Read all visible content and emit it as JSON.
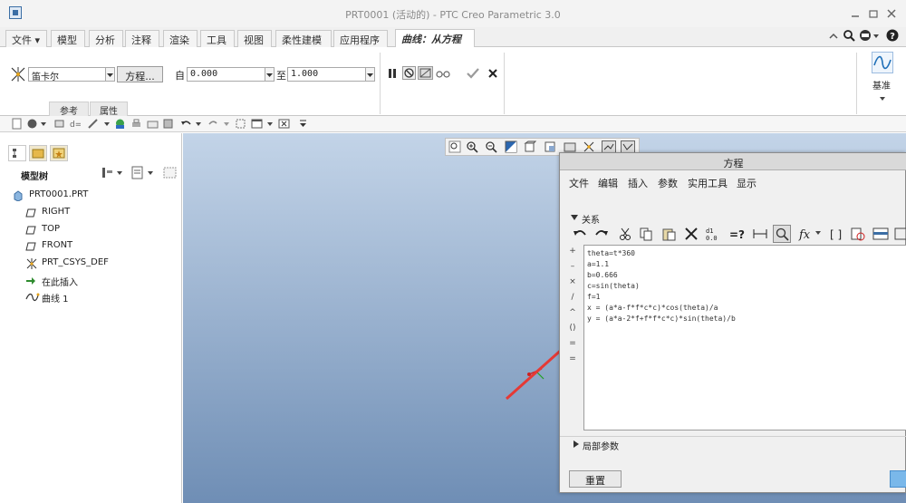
{
  "window": {
    "title": "PRT0001 (活动的) - PTC Creo Parametric 3.0"
  },
  "tabs": [
    {
      "label": "文件"
    },
    {
      "label": "模型"
    },
    {
      "label": "分析"
    },
    {
      "label": "注释"
    },
    {
      "label": "渲染"
    },
    {
      "label": "工具"
    },
    {
      "label": "视图"
    },
    {
      "label": "柔性建模"
    },
    {
      "label": "应用程序"
    },
    {
      "label": "曲线：从方程"
    }
  ],
  "ribbon": {
    "coord_system": "笛卡尔",
    "equation_button": "方程...",
    "from_label": "自",
    "from_value": "0.000",
    "to_label": "至",
    "to_value": "1.000",
    "subtabs": [
      "参考",
      "属性"
    ],
    "datum_label": "基准"
  },
  "left_pane": {
    "header": "模型树",
    "items": [
      {
        "label": "PRT0001.PRT",
        "icon": "part-icon"
      },
      {
        "label": "RIGHT",
        "icon": "datum-plane-icon"
      },
      {
        "label": "TOP",
        "icon": "datum-plane-icon"
      },
      {
        "label": "FRONT",
        "icon": "datum-plane-icon"
      },
      {
        "label": "PRT_CSYS_DEF",
        "icon": "csys-icon"
      },
      {
        "label": "在此插入",
        "icon": "insert-arrow-icon"
      },
      {
        "label": "曲线 1",
        "icon": "curve-icon"
      }
    ]
  },
  "dialog": {
    "title": "方程",
    "menu": [
      "文件",
      "编辑",
      "插入",
      "参数",
      "实用工具",
      "显示"
    ],
    "section": "关系",
    "equations": [
      "theta=t*360",
      "a=1.1",
      "b=0.666",
      "c=sin(theta)",
      "f=1",
      "x = (a*a-f*f*c*c)*cos(theta)/a",
      "y = (a*a-2*f+f*f*c*c)*sin(theta)/b"
    ],
    "operators": [
      "+",
      "–",
      "×",
      "/",
      "^",
      "()",
      "=",
      "="
    ],
    "local_params": "局部参数",
    "reset_button": "重置"
  },
  "colors": {
    "accent": "#1e6fb8",
    "arrow": "#e53935",
    "viewport_top": "#c3d4e8",
    "viewport_bottom": "#6f8eb5"
  }
}
